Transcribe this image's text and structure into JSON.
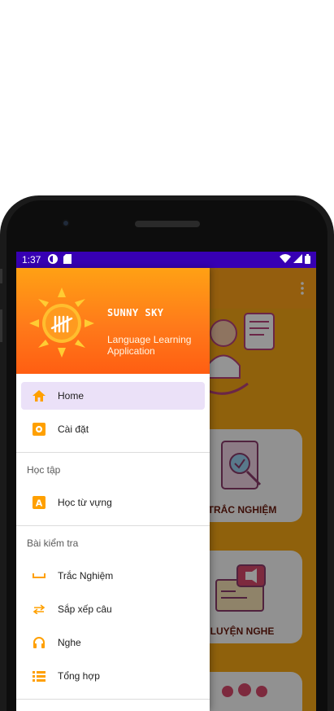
{
  "status_bar": {
    "time": "1:37"
  },
  "drawer": {
    "brand": "SUNNY SKY",
    "subtitle": "Language Learning Application",
    "items": [
      {
        "label": "Home",
        "icon": "home-icon",
        "active": true
      },
      {
        "label": "Cài đặt",
        "icon": "settings-icon"
      }
    ],
    "sections": [
      {
        "title": "Học tập",
        "items": [
          {
            "label": "Học từ vựng",
            "icon": "letter-a-icon"
          }
        ]
      },
      {
        "title": "Bài kiểm tra",
        "items": [
          {
            "label": "Trắc Nghiệm",
            "icon": "space-bar-icon"
          },
          {
            "label": "Sắp xếp câu",
            "icon": "swap-icon"
          },
          {
            "label": "Nghe",
            "icon": "headphones-icon"
          },
          {
            "label": "Tổng hợp",
            "icon": "list-icon"
          }
        ]
      }
    ]
  },
  "background": {
    "cards": [
      {
        "label": "TRẮC NGHIỆM"
      },
      {
        "label": "LUYỆN NGHE"
      }
    ]
  },
  "colors": {
    "accent": "#ffa319",
    "status_bar": "#3700b3",
    "icon": "#ffa000",
    "active_bg": "#ebe1f8"
  }
}
